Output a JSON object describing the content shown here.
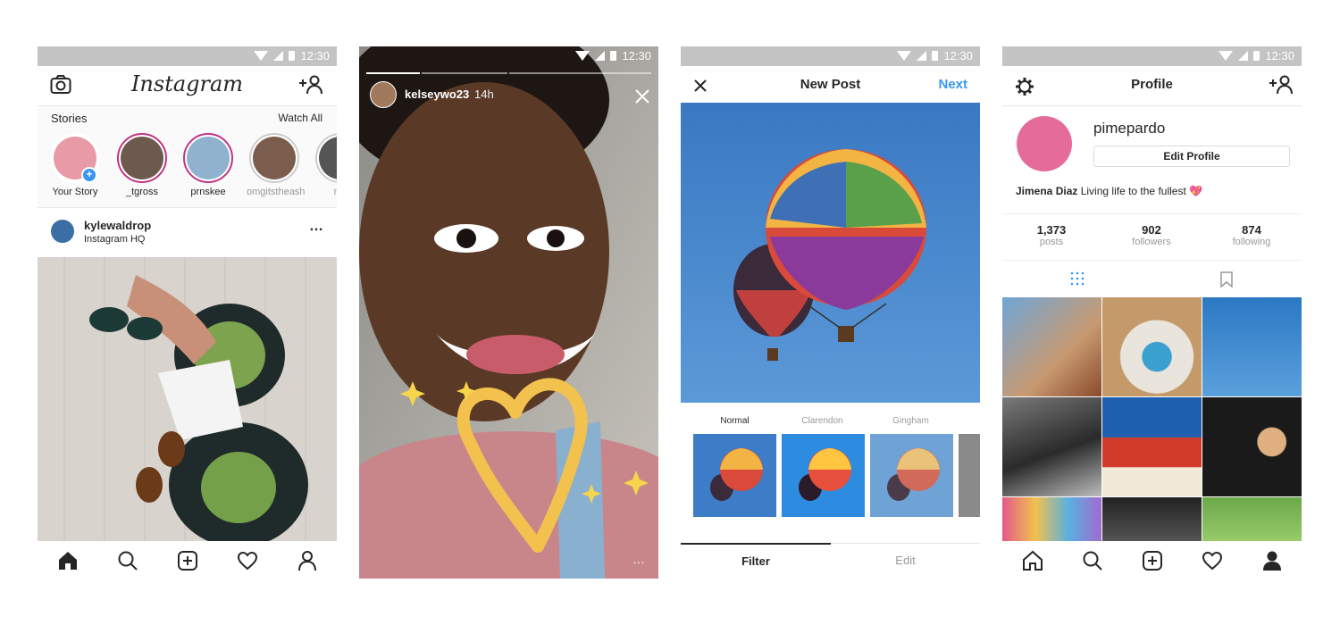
{
  "status": {
    "time": "12:30"
  },
  "feed": {
    "logo": "Instagram",
    "stories_label": "Stories",
    "watch_all": "Watch All",
    "stories": [
      {
        "name": "Your Story",
        "seen": false
      },
      {
        "name": "_tgross",
        "seen": false
      },
      {
        "name": "prnskee",
        "seen": false
      },
      {
        "name": "omgitstheash",
        "seen": true
      },
      {
        "name": "mc",
        "seen": true
      }
    ],
    "post": {
      "username": "kylewaldrop",
      "location": "Instagram HQ",
      "more": "…"
    }
  },
  "story": {
    "username": "kelseywo23",
    "time": "14h",
    "more": "…"
  },
  "new_post": {
    "title": "New Post",
    "next": "Next",
    "filters": [
      "Normal",
      "Clarendon",
      "Gingham"
    ],
    "tabs": {
      "filter": "Filter",
      "edit": "Edit"
    }
  },
  "profile": {
    "title": "Profile",
    "username": "pimepardo",
    "edit_button": "Edit Profile",
    "bio_name": "Jimena Diaz",
    "bio_text": "Living life to the fullest 💖",
    "stats": [
      {
        "num": "1,373",
        "label": "posts"
      },
      {
        "num": "902",
        "label": "followers"
      },
      {
        "num": "874",
        "label": "following"
      }
    ]
  },
  "colors": {
    "accent": "#3897f0",
    "story_ring": "#c13584",
    "status_bar": "#c4c4c4"
  }
}
